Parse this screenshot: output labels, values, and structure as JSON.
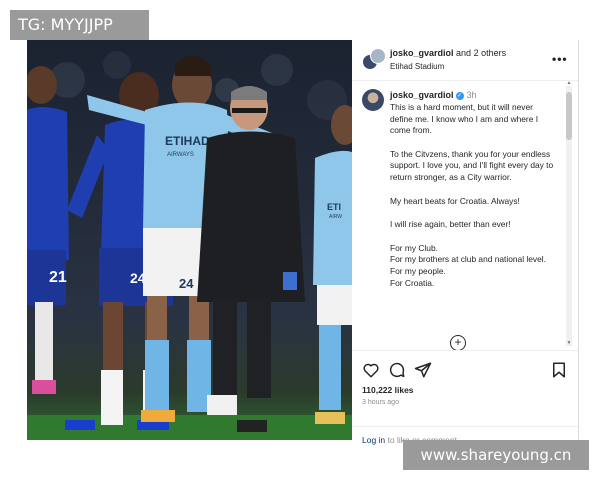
{
  "tag_label": "TG: MYYJJPP",
  "watermark_label": "www.shareyoung.cn",
  "photo": {
    "shirt_text_city": "ETIHAD",
    "shirt_text_city_sub": "AIRWAYS",
    "shirt_text_right": "ETI",
    "shirt_text_right_sub": "AIRW",
    "number_left": "21",
    "number_chelsea": "24",
    "number_city": "24"
  },
  "post": {
    "header": {
      "username": "josko_gvardiol",
      "and_others": "and 2 others",
      "location": "Etihad Stadium",
      "more_label": "•••"
    },
    "caption": {
      "username": "josko_gvardiol",
      "time": "3h",
      "paragraphs": [
        "This is a hard moment, but it will never define me. I know who I am and where I come from.",
        "To the Citvzens, thank you for your endless support. I love you, and I'll fight every day to return stronger, as a City warrior.",
        "My heart beats for Croatia. Always!",
        "I will rise again, better than ever!"
      ],
      "closing_lines": [
        "For my Club.",
        "For my brothers at club and national level.",
        "For my people.",
        "For Croatia."
      ]
    },
    "likes": "110,222 likes",
    "posted_ago": "3 hours ago",
    "login_link": "Log in",
    "login_rest": "to like or comment."
  },
  "colors": {
    "city_blue": "#8fc7ea",
    "chelsea_blue": "#1f3fb0",
    "grass": "#2f7a2e",
    "ig_link": "#00376b",
    "verified": "#3897f0"
  }
}
